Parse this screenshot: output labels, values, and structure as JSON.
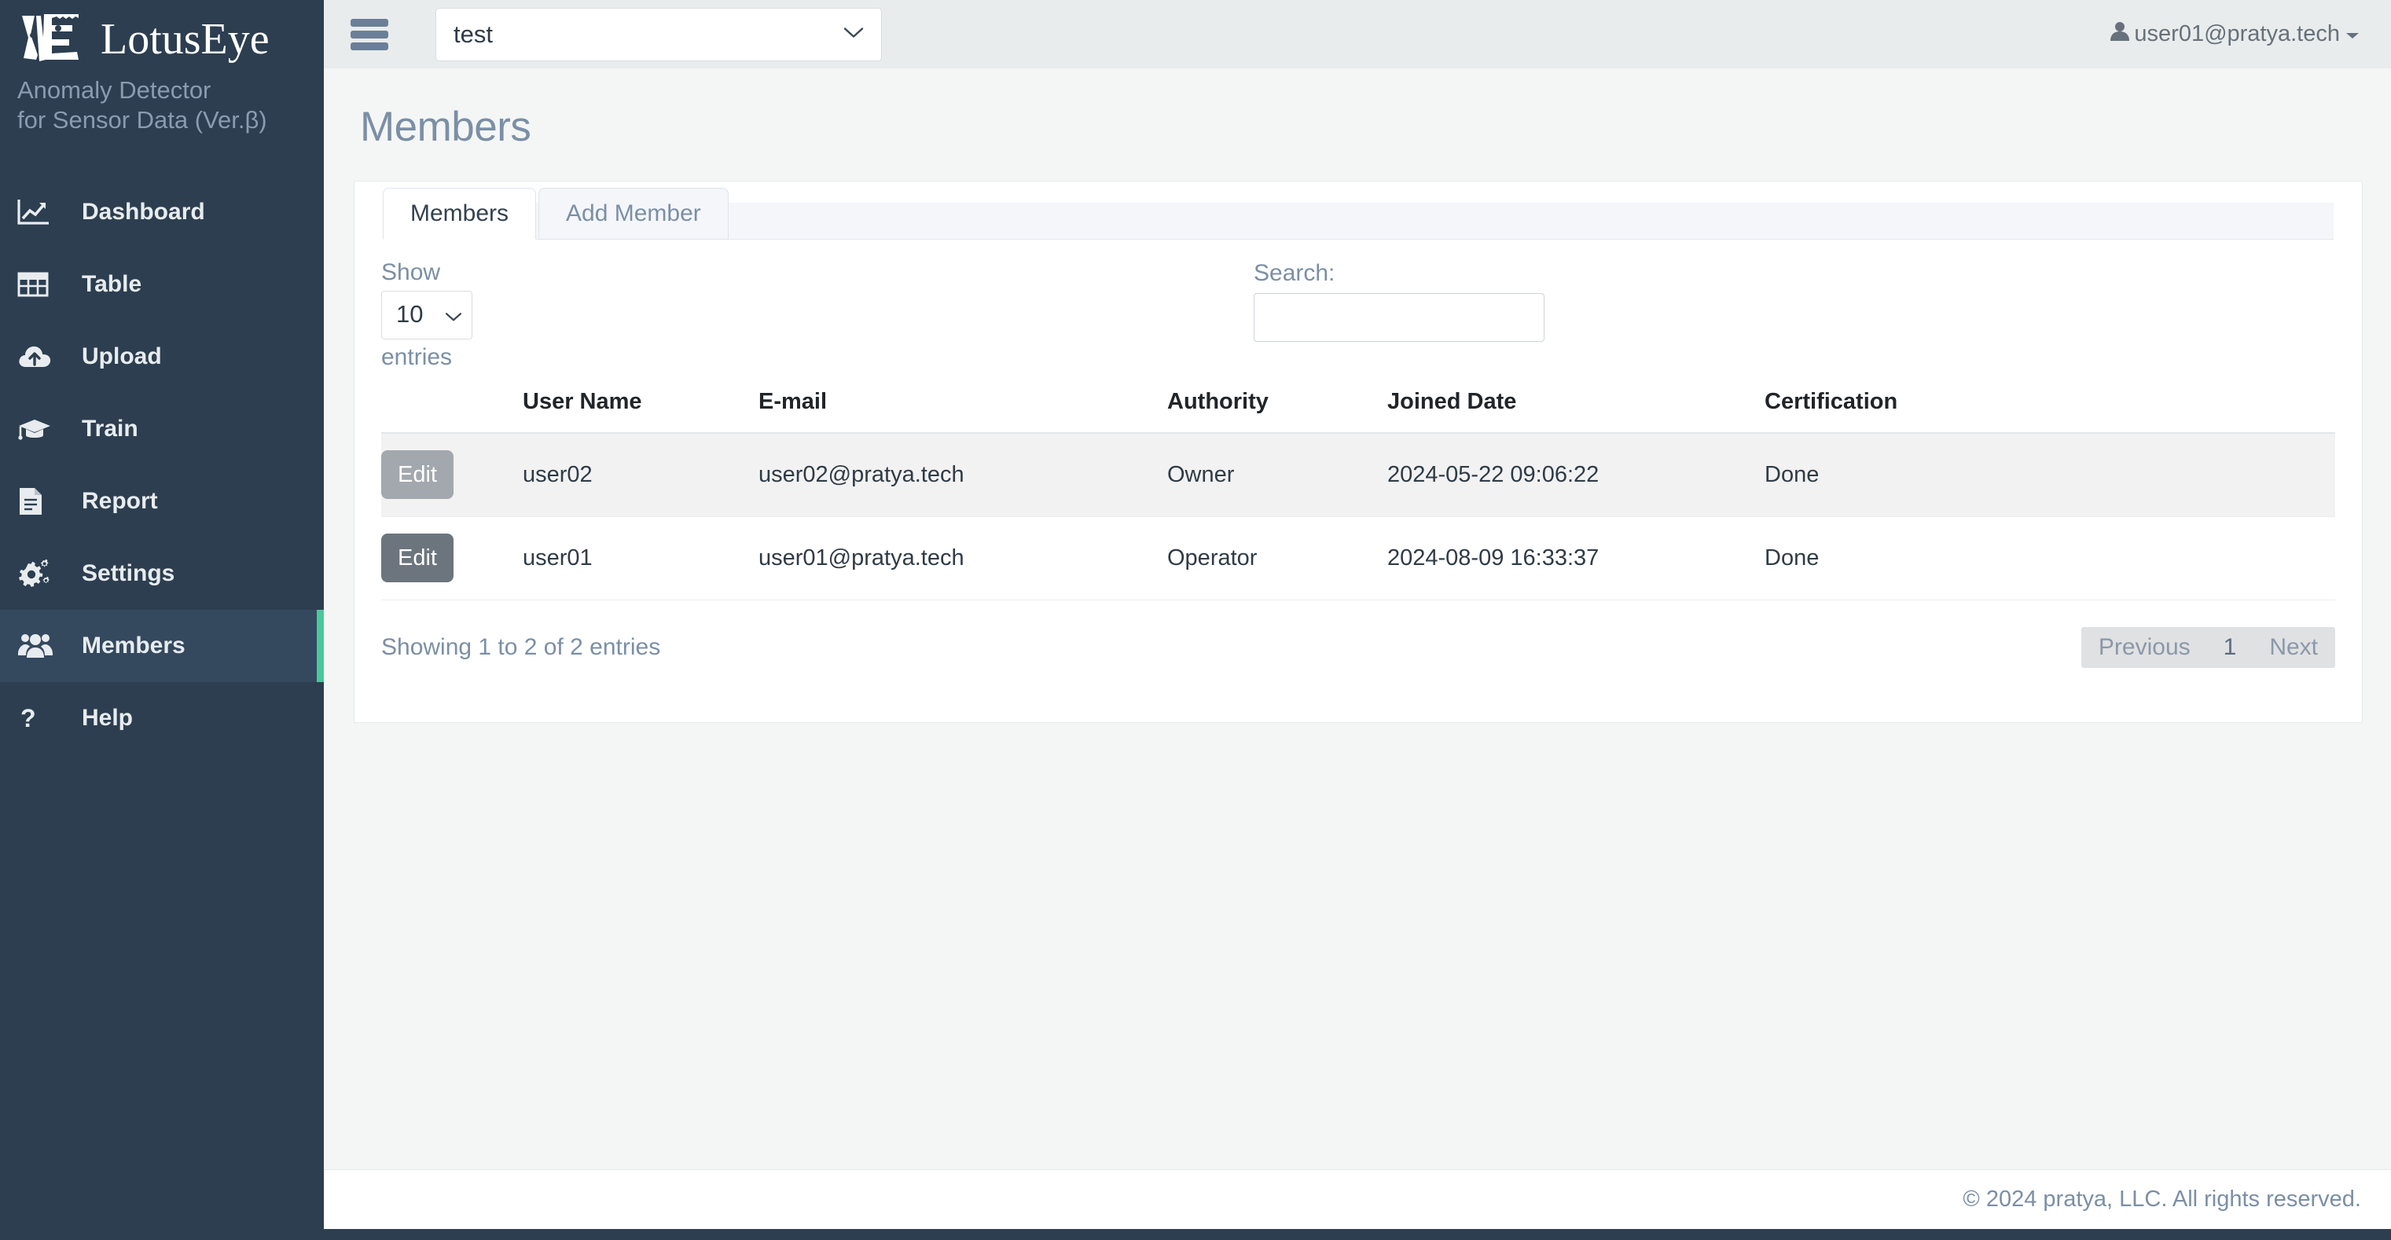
{
  "sidebar": {
    "brand_name": "LotusEye",
    "brand_sub_line1": "Anomaly Detector",
    "brand_sub_line2": "for Sensor Data (Ver.β)",
    "items": [
      {
        "label": "Dashboard",
        "icon": "chart-line-icon",
        "active": false
      },
      {
        "label": "Table",
        "icon": "table-grid-icon",
        "active": false
      },
      {
        "label": "Upload",
        "icon": "cloud-upload-icon",
        "active": false
      },
      {
        "label": "Train",
        "icon": "graduation-cap-icon",
        "active": false
      },
      {
        "label": "Report",
        "icon": "document-icon",
        "active": false
      },
      {
        "label": "Settings",
        "icon": "gears-icon",
        "active": false
      },
      {
        "label": "Members",
        "icon": "users-icon",
        "active": true
      },
      {
        "label": "Help",
        "icon": "question-mark-icon",
        "active": false
      }
    ],
    "accent_color": "#4ac89a",
    "background_color": "#2c3e50",
    "active_background_color": "#34495e"
  },
  "topbar": {
    "menu_icon": "hamburger-icon",
    "project_select_value": "test",
    "project_select_icon": "chevron-down-icon",
    "user_icon": "user-icon",
    "user_email": "user01@pratya.tech",
    "user_caret_icon": "caret-down-icon"
  },
  "page": {
    "title": "Members"
  },
  "tabs": [
    {
      "label": "Members",
      "active": true
    },
    {
      "label": "Add Member",
      "active": false
    }
  ],
  "controls": {
    "show_label": "Show",
    "entries_label": "entries",
    "length_value": "10",
    "length_icon": "chevron-down-icon",
    "search_label": "Search:",
    "search_value": "",
    "search_placeholder": ""
  },
  "table": {
    "columns": [
      "",
      "User Name",
      "E-mail",
      "Authority",
      "Joined Date",
      "Certification"
    ],
    "rows": [
      {
        "edit_label": "Edit",
        "edit_enabled": false,
        "user_name": "user02",
        "email": "user02@pratya.tech",
        "authority": "Owner",
        "joined_date": "2024-05-22 09:06:22",
        "certification": "Done"
      },
      {
        "edit_label": "Edit",
        "edit_enabled": true,
        "user_name": "user01",
        "email": "user01@pratya.tech",
        "authority": "Operator",
        "joined_date": "2024-08-09 16:33:37",
        "certification": "Done"
      }
    ]
  },
  "table_footer": {
    "info": "Showing 1 to 2 of 2 entries",
    "previous_label": "Previous",
    "page_number": "1",
    "next_label": "Next"
  },
  "footer": {
    "copyright": "© 2024 pratya, LLC. All rights reserved."
  }
}
